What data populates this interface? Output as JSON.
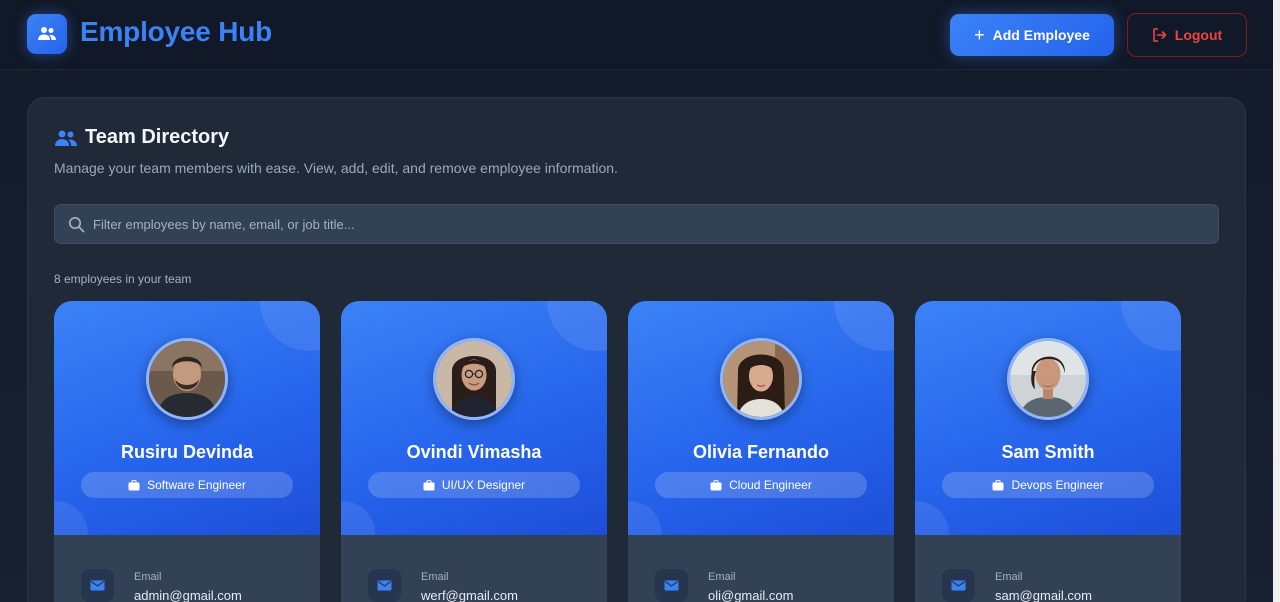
{
  "header": {
    "title": "Employee Hub",
    "add_label": "Add Employee",
    "add_icon": "plus-icon",
    "logout_label": "Logout",
    "logout_icon": "logout-icon",
    "logo_icon": "users-icon"
  },
  "directory": {
    "title": "Team Directory",
    "subtitle": "Manage your team members with ease. View, add, edit, and remove employee information.",
    "search_placeholder": "Filter employees by name, email, or job title...",
    "search_value": "",
    "count_text": "8 employees in your team"
  },
  "email_label": "Email",
  "employees": [
    {
      "name": "Rusiru Devinda",
      "role": "Software Engineer",
      "email": "admin@gmail.com"
    },
    {
      "name": "Ovindi Vimasha",
      "role": "UI/UX Designer",
      "email": "werf@gmail.com"
    },
    {
      "name": "Olivia Fernando",
      "role": "Cloud Engineer",
      "email": "oli@gmail.com"
    },
    {
      "name": "Sam Smith",
      "role": "Devops Engineer",
      "email": "sam@gmail.com"
    }
  ],
  "colors": {
    "accent": "#3b82f6",
    "accent_dark": "#2563eb",
    "danger": "#ef4444",
    "background": "#151d2e",
    "panel": "#1f2937"
  }
}
